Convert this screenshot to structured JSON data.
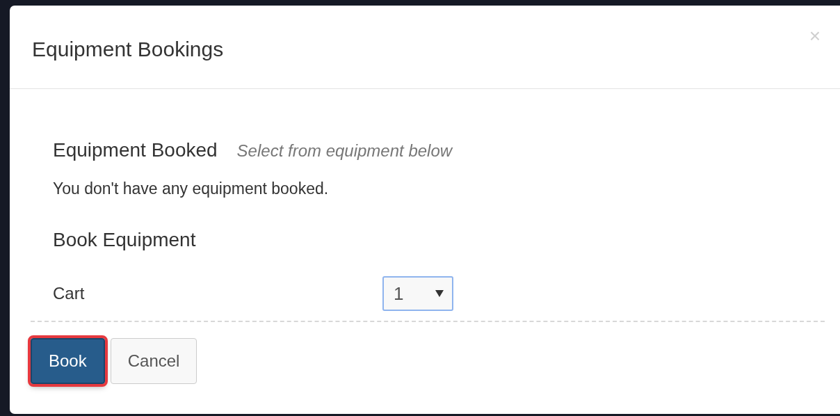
{
  "dialog": {
    "title": "Equipment Bookings",
    "close": "×"
  },
  "booked": {
    "heading": "Equipment Booked",
    "hint": "Select from equipment below",
    "message": "You don't have any equipment booked."
  },
  "book": {
    "heading": "Book Equipment",
    "rows": [
      {
        "label": "Cart",
        "value": "1",
        "focused": true
      }
    ]
  },
  "buttons": [
    {
      "label": "Book",
      "kind": "primary",
      "highlighted": true
    },
    {
      "label": "Cancel",
      "kind": "default",
      "highlighted": false
    }
  ]
}
